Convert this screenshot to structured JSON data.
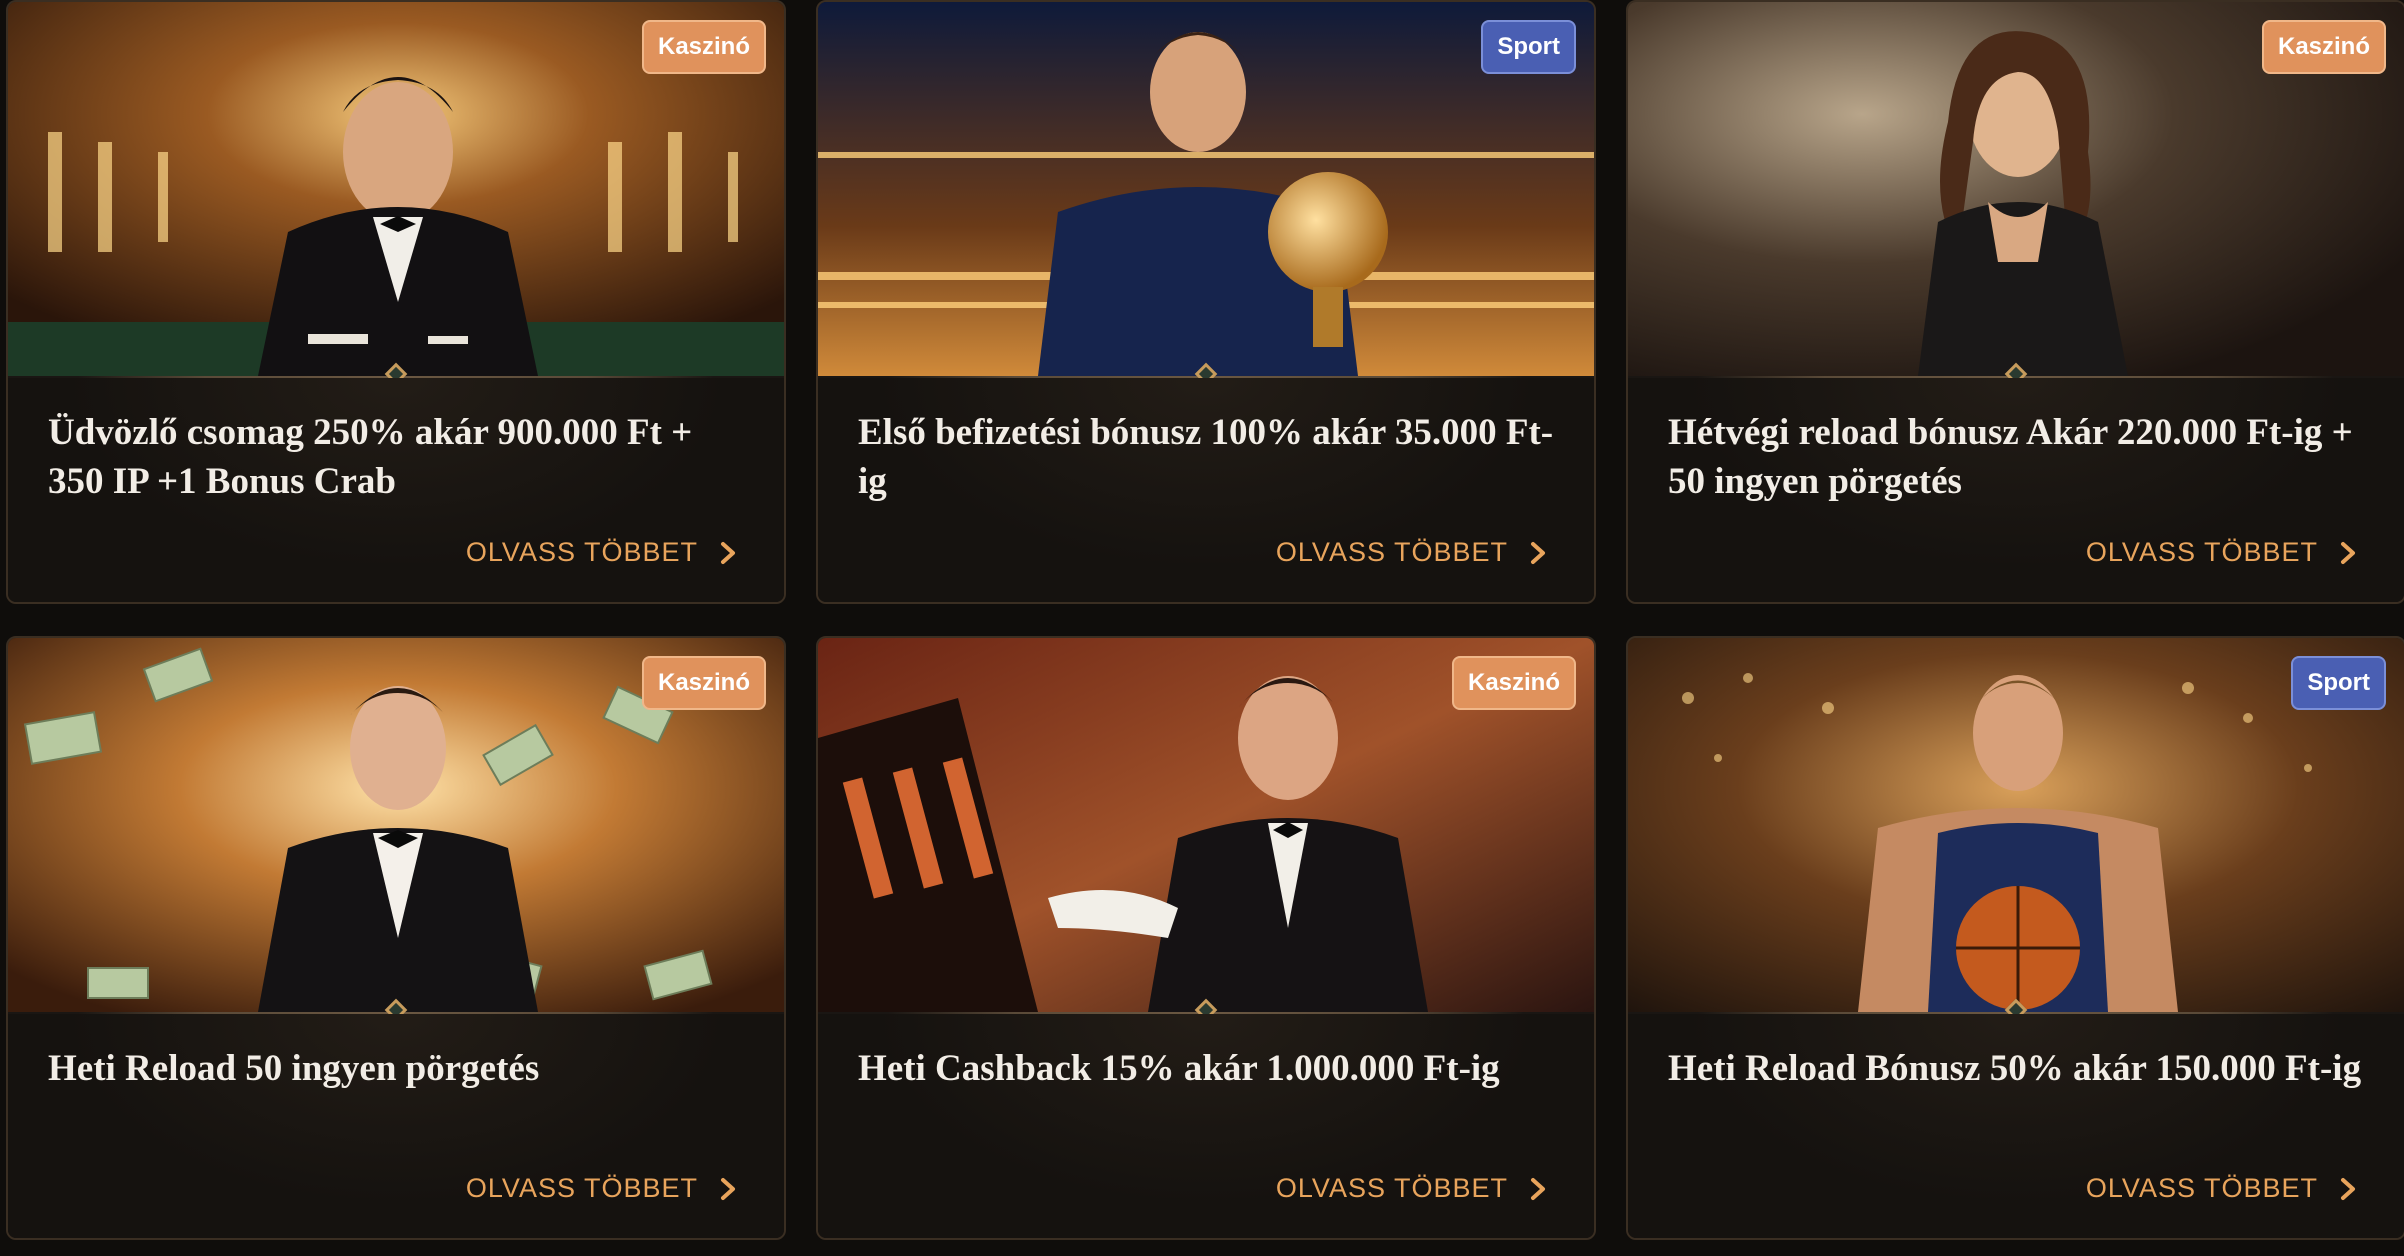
{
  "read_more_label": "OLVASS TÖBBET",
  "badge_colors": {
    "Kaszinó": "#e0925c",
    "Sport": "#4a5fb3"
  },
  "cards": [
    {
      "badge": "Kaszinó",
      "title": "Üdvözlő csomag 250% akár 900.000 Ft + 350 IP +1 Bonus Crab",
      "image": "casino-dealer-tuxedo"
    },
    {
      "badge": "Sport",
      "title": "Első befizetési bónusz 100% akár 35.000 Ft-ig",
      "image": "football-player-trophy"
    },
    {
      "badge": "Kaszinó",
      "title": "Hétvégi reload bónusz Akár 220.000 Ft-ig + 50 ingyen pörgetés",
      "image": "woman-casino-lounge"
    },
    {
      "badge": "Kaszinó",
      "title": "Heti Reload 50 ingyen pörgetés",
      "image": "man-money-rain"
    },
    {
      "badge": "Kaszinó",
      "title": "Heti Cashback 15% akár 1.000.000 Ft-ig",
      "image": "man-slot-machine"
    },
    {
      "badge": "Sport",
      "title": "Heti Reload Bónusz 50% akár 150.000 Ft-ig",
      "image": "basketball-player"
    }
  ]
}
